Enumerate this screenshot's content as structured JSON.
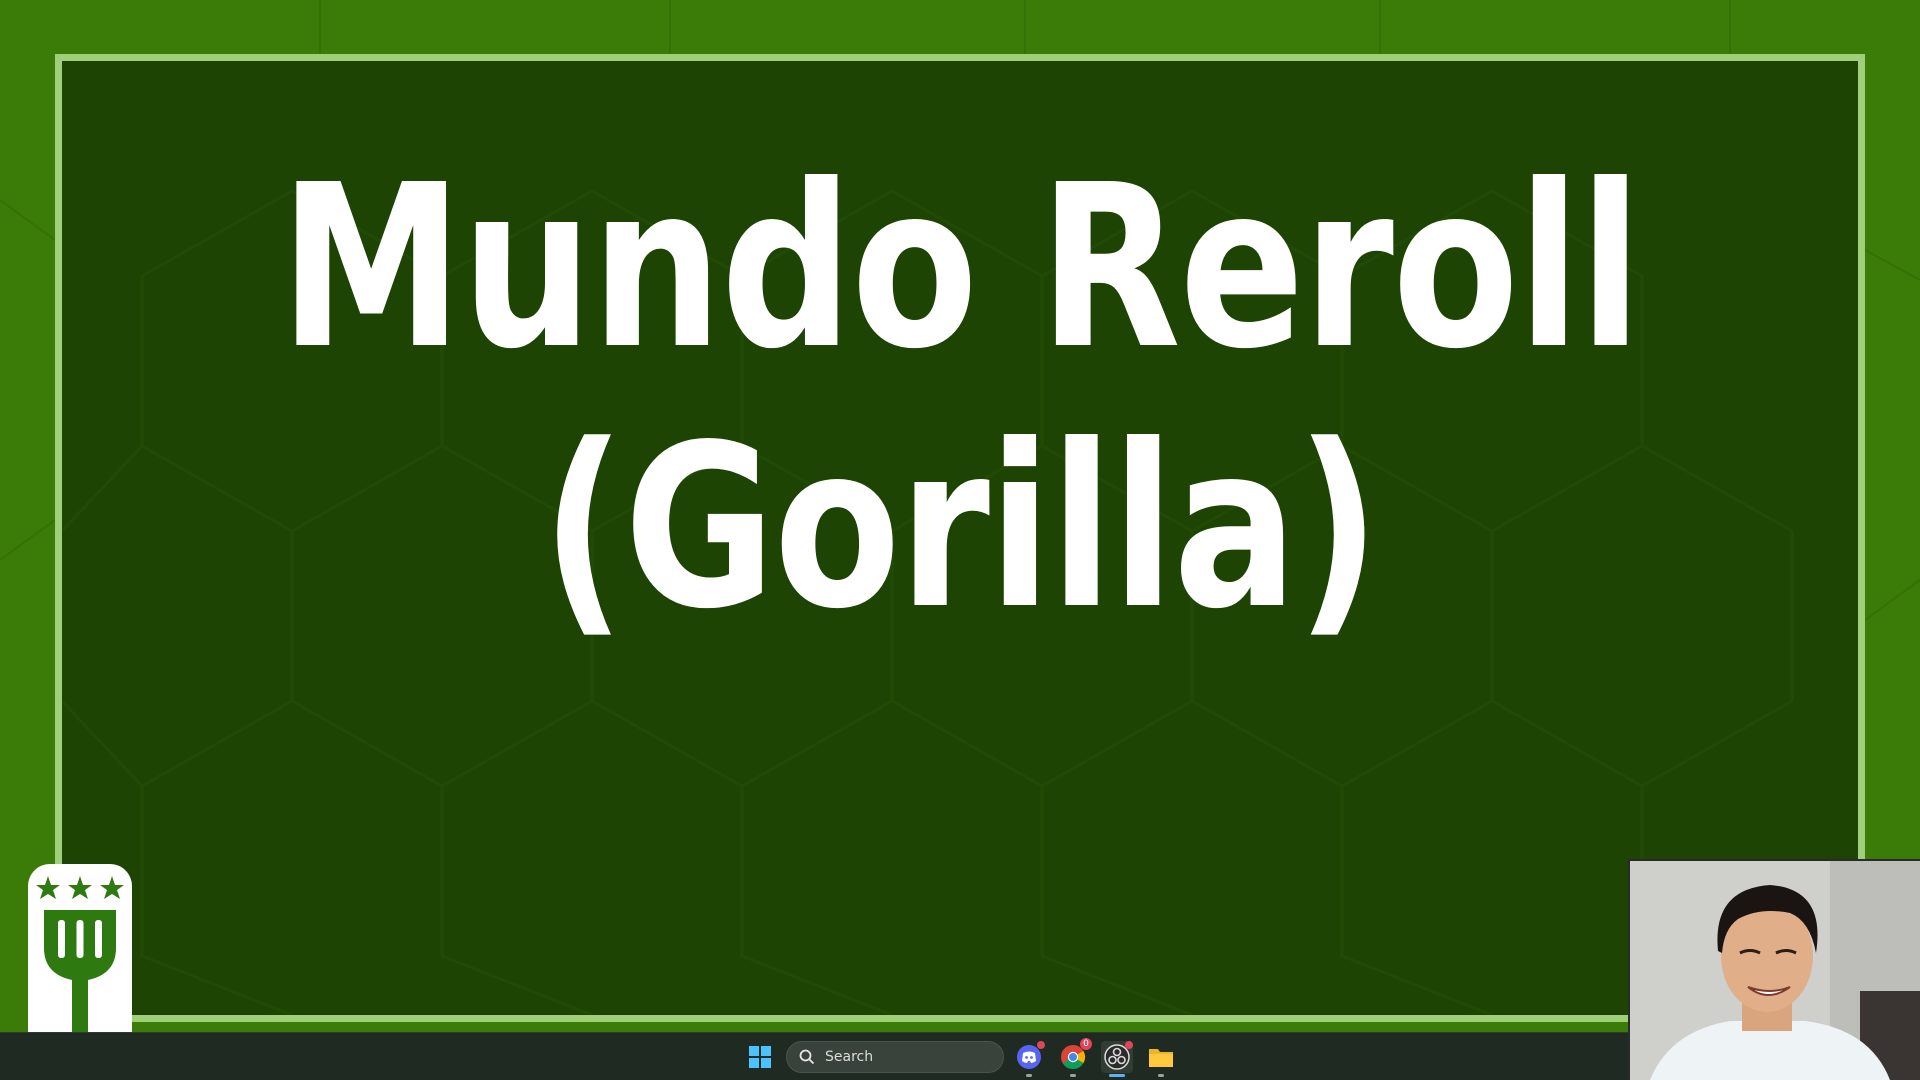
{
  "slide": {
    "title_line1": "Mundo Reroll",
    "title_line2": "(Gorilla)"
  },
  "taskbar": {
    "search_placeholder": "Search",
    "chrome_badge": "0",
    "items": [
      {
        "name": "windows-start-icon"
      },
      {
        "name": "discord-icon"
      },
      {
        "name": "chrome-icon"
      },
      {
        "name": "obs-icon"
      },
      {
        "name": "file-explorer-icon"
      }
    ]
  },
  "colors": {
    "background": "#3b7c08",
    "panel": "#1d4403",
    "panel_border": "#9fcf78",
    "title_text": "#ffffff",
    "taskbar": "#1f2a22"
  }
}
